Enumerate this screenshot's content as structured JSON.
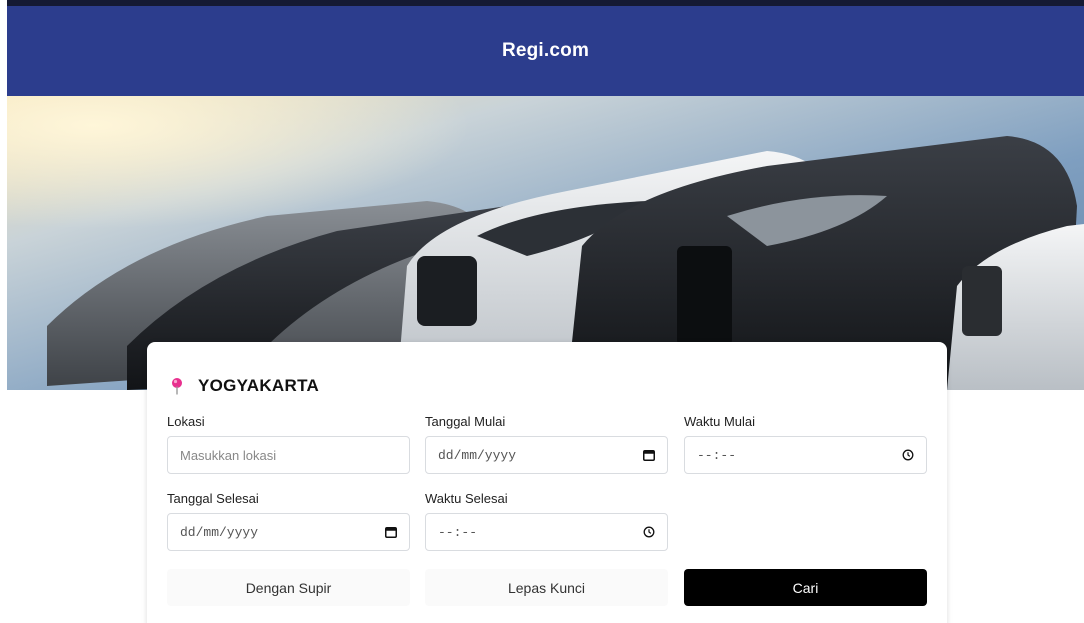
{
  "header": {
    "brand": "Regi.com"
  },
  "search": {
    "city": "YOGYAKARTA",
    "fields": {
      "lokasi": {
        "label": "Lokasi",
        "placeholder": "Masukkan lokasi"
      },
      "tanggal_mulai": {
        "label": "Tanggal Mulai",
        "value": "dd/mm/yyyy"
      },
      "waktu_mulai": {
        "label": "Waktu Mulai",
        "value": "--:--"
      },
      "tanggal_selesai": {
        "label": "Tanggal Selesai",
        "value": "dd/mm/yyyy"
      },
      "waktu_selesai": {
        "label": "Waktu Selesai",
        "value": "--:--"
      }
    },
    "buttons": {
      "dengan_supir": "Dengan Supir",
      "lepas_kunci": "Lepas Kunci",
      "cari": "Cari"
    }
  },
  "icons": {
    "pin": "map-pin-icon",
    "calendar": "calendar-icon",
    "clock": "clock-icon"
  },
  "colors": {
    "header_bg": "#2c3d8d",
    "pin": "#e8308e",
    "primary_button": "#000000"
  }
}
